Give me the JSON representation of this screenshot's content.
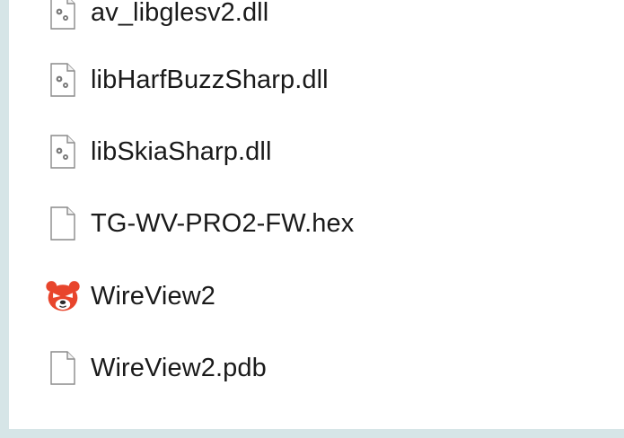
{
  "explorer": {
    "files": [
      {
        "name": "av_libglesv2.dll",
        "icon": "dll-gear-icon"
      },
      {
        "name": "libHarfBuzzSharp.dll",
        "icon": "dll-gear-icon"
      },
      {
        "name": "libSkiaSharp.dll",
        "icon": "dll-gear-icon"
      },
      {
        "name": "TG-WV-PRO2-FW.hex",
        "icon": "blank-file-icon"
      },
      {
        "name": "WireView2",
        "icon": "red-bear-app-icon"
      },
      {
        "name": "WireView2.pdb",
        "icon": "blank-file-icon"
      }
    ],
    "colors": {
      "background": "#d6e5e7",
      "panel": "#ffffff",
      "text": "#1a1a1a",
      "app_icon": "#e8452c"
    }
  }
}
